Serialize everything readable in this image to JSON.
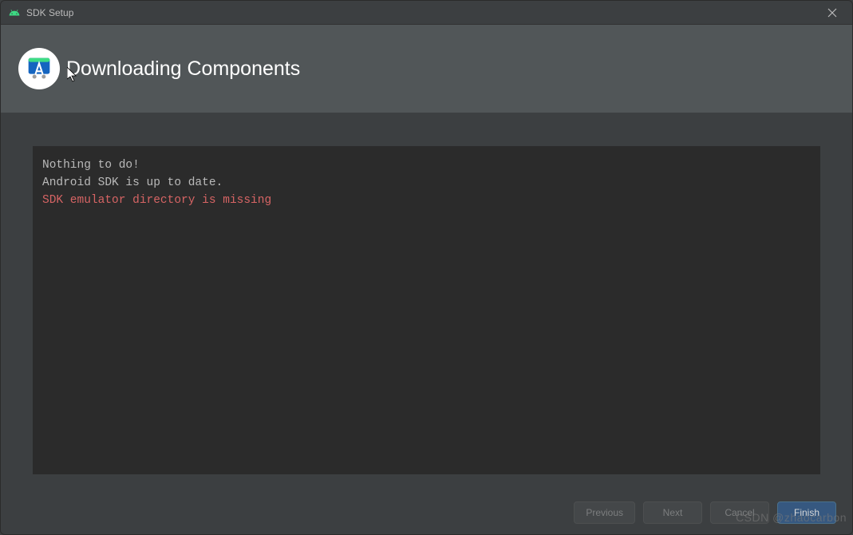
{
  "window": {
    "title": "SDK Setup"
  },
  "header": {
    "title": "Downloading Components"
  },
  "console": {
    "lines": [
      {
        "text": "Nothing to do!",
        "type": "normal"
      },
      {
        "text": "Android SDK is up to date.",
        "type": "normal"
      },
      {
        "text": "SDK emulator directory is missing",
        "type": "error"
      }
    ]
  },
  "buttons": {
    "previous": {
      "label": "Previous",
      "enabled": false
    },
    "next": {
      "label": "Next",
      "enabled": false
    },
    "cancel": {
      "label": "Cancel",
      "enabled": false
    },
    "finish": {
      "label": "Finish",
      "enabled": true
    }
  },
  "watermark": "CSDN @zhaocarbon"
}
